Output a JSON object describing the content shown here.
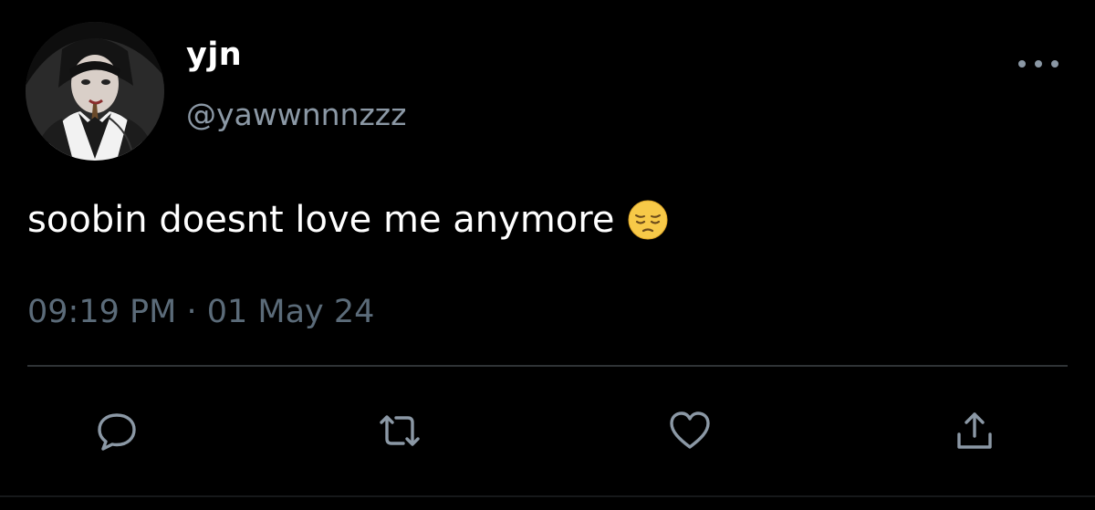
{
  "tweet": {
    "display_name": "yjn",
    "handle": "@yawwnnnzzz",
    "text": "soobin doesnt love me anymore",
    "text_emoji": "pensive-face-emoji",
    "time": "09:19 PM",
    "separator": "·",
    "date": "01 May 24"
  },
  "actions": [
    {
      "name": "reply",
      "icon": "speech-bubble-icon"
    },
    {
      "name": "retweet",
      "icon": "retweet-icon"
    },
    {
      "name": "like",
      "icon": "heart-icon"
    },
    {
      "name": "share",
      "icon": "share-upload-icon"
    }
  ],
  "colors": {
    "background": "#000000",
    "primary_text": "#ffffff",
    "secondary_text": "#8b98a5",
    "meta_text": "#5b6b79",
    "divider": "#2f3336",
    "icon": "#8b98a5"
  }
}
